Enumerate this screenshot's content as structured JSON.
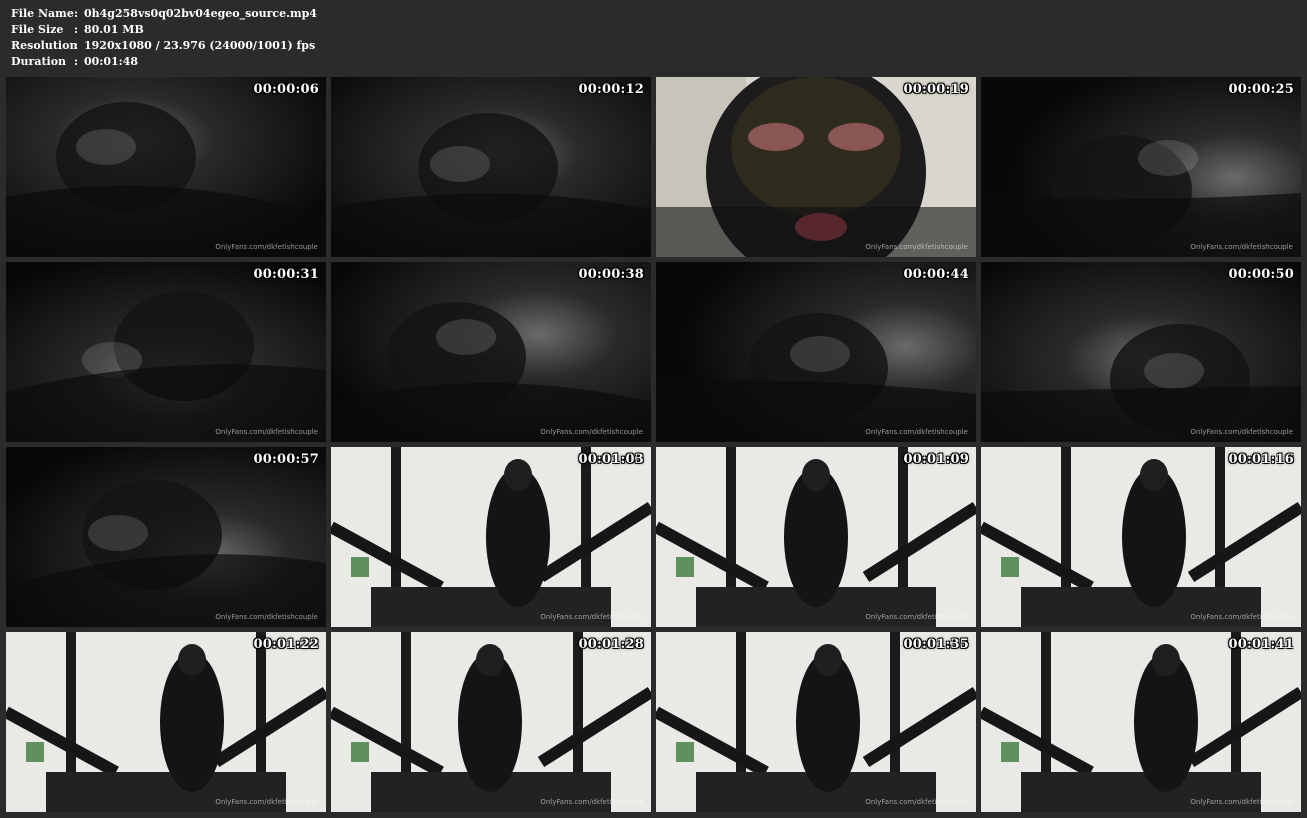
{
  "info": {
    "file_name": {
      "key": "File Name",
      "value": "0h4g258vs0q02bv04egeo_source.mp4"
    },
    "file_size": {
      "key": "File Size",
      "value": "80.01 MB"
    },
    "resolution": {
      "key": "Resolution",
      "value": "1920x1080 / 23.976 (24000/1001) fps"
    },
    "duration": {
      "key": "Duration",
      "value": "00:01:48"
    },
    "separator": ":"
  },
  "thumbnails": [
    {
      "time": "00:00:06",
      "scene": "dark",
      "watermark": "OnlyFans.com/dkfetishcouple"
    },
    {
      "time": "00:00:12",
      "scene": "dark",
      "watermark": ""
    },
    {
      "time": "00:00:19",
      "scene": "mask-closeup",
      "watermark": "OnlyFans.com/dkfetishcouple"
    },
    {
      "time": "00:00:25",
      "scene": "dark",
      "watermark": "OnlyFans.com/dkfetishcouple"
    },
    {
      "time": "00:00:31",
      "scene": "dark",
      "watermark": "OnlyFans.com/dkfetishcouple"
    },
    {
      "time": "00:00:38",
      "scene": "dark",
      "watermark": "OnlyFans.com/dkfetishcouple"
    },
    {
      "time": "00:00:44",
      "scene": "dark",
      "watermark": "OnlyFans.com/dkfetishcouple"
    },
    {
      "time": "00:00:50",
      "scene": "dark",
      "watermark": "OnlyFans.com/dkfetishcouple"
    },
    {
      "time": "00:00:57",
      "scene": "dark",
      "watermark": "OnlyFans.com/dkfetishcouple"
    },
    {
      "time": "00:01:03",
      "scene": "room",
      "watermark": "OnlyFans.com/dkfetishcouple"
    },
    {
      "time": "00:01:09",
      "scene": "room",
      "watermark": "OnlyFans.com/dkfetishcouple"
    },
    {
      "time": "00:01:16",
      "scene": "room",
      "watermark": "OnlyFans.com/dkfetishcouple"
    },
    {
      "time": "00:01:22",
      "scene": "room",
      "watermark": "OnlyFans.com/dkfetishcouple"
    },
    {
      "time": "00:01:28",
      "scene": "room",
      "watermark": "OnlyFans.com/dkfetishcouple"
    },
    {
      "time": "00:01:35",
      "scene": "room",
      "watermark": "OnlyFans.com/dkfetishcouple"
    },
    {
      "time": "00:01:41",
      "scene": "room",
      "watermark": "OnlyFans.com/dkfetishcouple"
    }
  ]
}
